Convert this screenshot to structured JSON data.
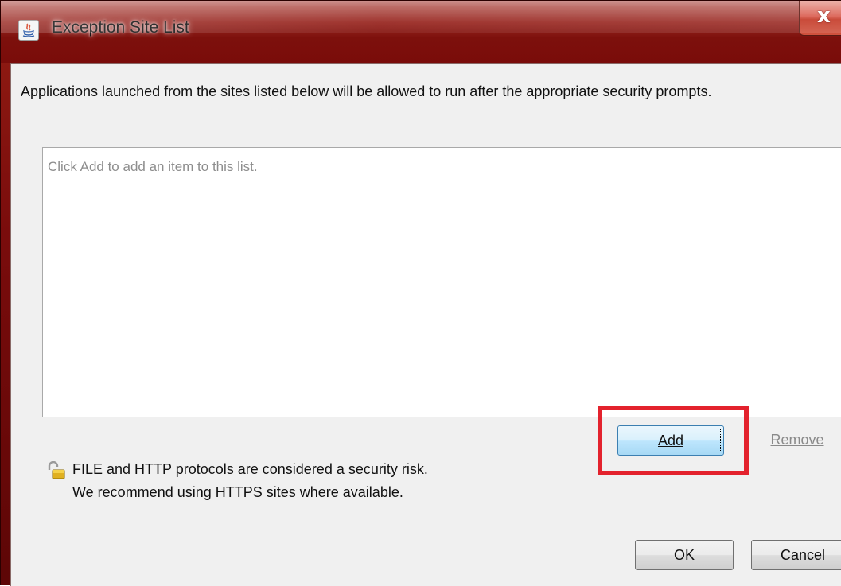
{
  "window": {
    "title": "Exception Site List",
    "close_glyph": "x",
    "icon": "java-icon"
  },
  "description": "Applications launched from the sites listed below will be allowed to run after the appropriate security prompts.",
  "site_list": {
    "placeholder": "Click Add to add an item to this list.",
    "items": []
  },
  "buttons": {
    "add": "Add",
    "remove": "Remove",
    "ok": "OK",
    "cancel": "Cancel"
  },
  "warning": {
    "icon": "unlocked-padlock-icon",
    "line1": "FILE and HTTP protocols are considered a security risk.",
    "line2": "We recommend using HTTPS sites where available."
  },
  "annotation": {
    "color": "#e3222d",
    "target": "add-button"
  },
  "colors": {
    "titlebar": "#7a0c0a",
    "client_bg": "#f0f0f0",
    "focus_blue": "#3c7fb1"
  }
}
